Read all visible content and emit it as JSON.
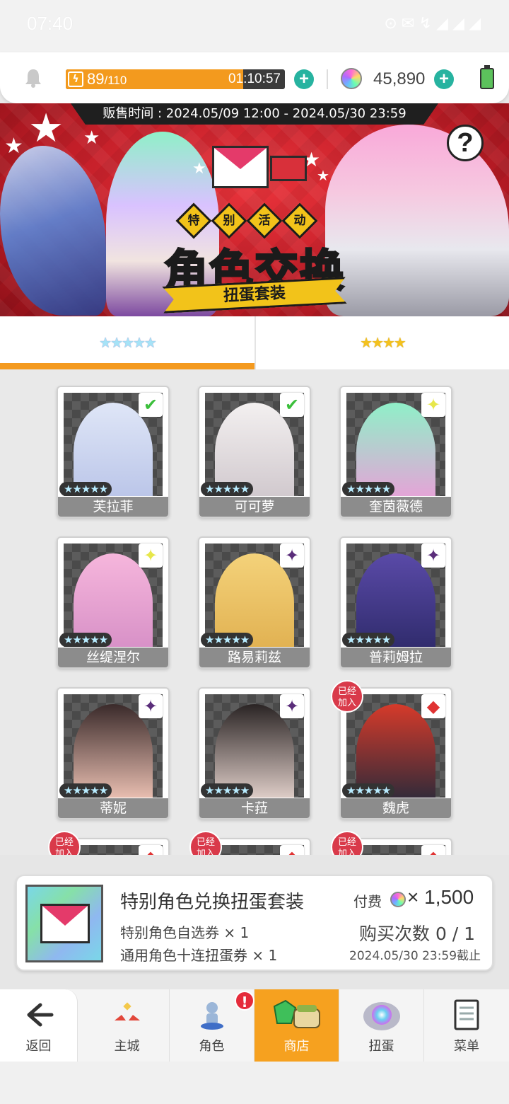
{
  "status_bar": {
    "time": "07:40",
    "indicators": "⊙ ✉ ↯ ◢ ◢ ◢"
  },
  "resources": {
    "stamina_current": "89",
    "stamina_max": "/110",
    "stamina_fraction": 0.81,
    "stamina_timer": "01:10:57",
    "gems": "45,890"
  },
  "banner": {
    "sale_period": "贩售时间 : 2024.05/09 12:00 - 2024.05/30 23:59",
    "badges": [
      "特",
      "别",
      "活",
      "动"
    ],
    "title": "角色交换",
    "subtitle": "扭蛋套装"
  },
  "tabs": [
    {
      "label": "★★★★★",
      "active": true
    },
    {
      "label": "★★★★",
      "active": false
    }
  ],
  "characters": [
    {
      "name": "芙拉菲",
      "stars": "★★★★★",
      "element": "leaf-icon",
      "element_glyph": "✔",
      "owned": false,
      "portrait": [
        "#dfe6f7",
        "#b9c4e8"
      ]
    },
    {
      "name": "可可萝",
      "stars": "★★★★★",
      "element": "leaf-icon",
      "element_glyph": "✔",
      "owned": false,
      "portrait": [
        "#f3f0f0",
        "#cfc7cc"
      ]
    },
    {
      "name": "奎茵薇德",
      "stars": "★★★★★",
      "element": "light-icon",
      "element_glyph": "✦",
      "owned": false,
      "portrait": [
        "#8ff0c8",
        "#e9a0d8"
      ]
    },
    {
      "name": "丝缇涅尔",
      "stars": "★★★★★",
      "element": "light-icon",
      "element_glyph": "✦",
      "owned": false,
      "portrait": [
        "#f6b6dc",
        "#d68fc6"
      ]
    },
    {
      "name": "路易莉兹",
      "stars": "★★★★★",
      "element": "dark-icon",
      "element_glyph": "✦",
      "owned": false,
      "portrait": [
        "#f4d27a",
        "#e0b050"
      ]
    },
    {
      "name": "普莉姆拉",
      "stars": "★★★★★",
      "element": "dark-icon",
      "element_glyph": "✦",
      "owned": false,
      "portrait": [
        "#5a4aa8",
        "#2e2a6a"
      ]
    },
    {
      "name": "蒂妮",
      "stars": "★★★★★",
      "element": "dark-icon",
      "element_glyph": "✦",
      "owned": false,
      "portrait": [
        "#3a2a2a",
        "#f2c6b8"
      ]
    },
    {
      "name": "卡菈",
      "stars": "★★★★★",
      "element": "dark-icon",
      "element_glyph": "✦",
      "owned": false,
      "portrait": [
        "#2a2424",
        "#e8d6d0"
      ]
    },
    {
      "name": "魏虎",
      "stars": "★★★★★",
      "element": "fire-icon",
      "element_glyph": "◆",
      "owned": true,
      "owned_label": "已经加入",
      "portrait": [
        "#d63a2a",
        "#2a2a3a"
      ]
    },
    {
      "name": "",
      "stars": "",
      "element": "fire-icon",
      "element_glyph": "◆",
      "owned": true,
      "owned_label": "已经加入",
      "portrait": [
        "#f2e6a8",
        "#e8d890"
      ]
    },
    {
      "name": "",
      "stars": "",
      "element": "fire-icon",
      "element_glyph": "◆",
      "owned": true,
      "owned_label": "已经加入",
      "portrait": [
        "#f29aa8",
        "#e07888"
      ]
    },
    {
      "name": "",
      "stars": "",
      "element": "fire-icon",
      "element_glyph": "◆",
      "owned": true,
      "owned_label": "已经加入",
      "portrait": [
        "#3a2a2a",
        "#f2d6c0"
      ]
    }
  ],
  "product": {
    "name": "特别角色兑换扭蛋套装",
    "items": [
      "特别角色自选券 × 1",
      "通用角色十连扭蛋券 × 1"
    ],
    "price_label": "付费",
    "price_value": "× 1,500",
    "purchase_count": "购买次数 0 / 1",
    "deadline": "2024.05/30 23:59截止"
  },
  "nav": [
    {
      "label": "返回",
      "icon": "arrow-left-icon"
    },
    {
      "label": "主城",
      "icon": "castle-icon"
    },
    {
      "label": "角色",
      "icon": "character-icon",
      "badge": "!"
    },
    {
      "label": "商店",
      "icon": "shop-icon",
      "active": true
    },
    {
      "label": "扭蛋",
      "icon": "gacha-icon"
    },
    {
      "label": "菜单",
      "icon": "menu-icon"
    }
  ],
  "colors": {
    "accent": "#f49a1f",
    "teal": "#27b3a0",
    "banner_red": "#c21e28",
    "owned_red": "#d93a4a"
  }
}
